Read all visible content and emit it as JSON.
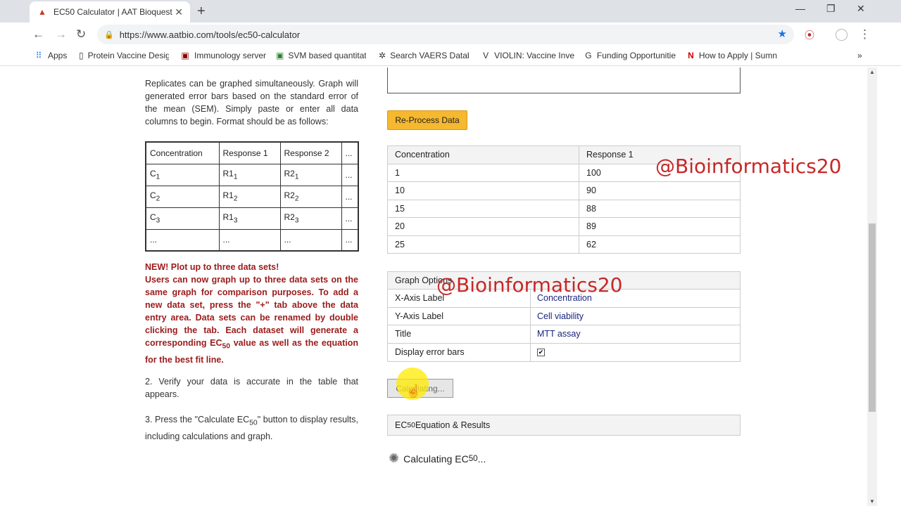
{
  "browser": {
    "tab_title": "EC50 Calculator | AAT Bioquest",
    "new_tab": "+",
    "url": "https://www.aatbio.com/tools/ec50-calculator",
    "bookmarks": [
      "Apps",
      "Protein Vaccine Desig",
      "Immunology server",
      "SVM based quantitat",
      "Search VAERS Databa",
      "VIOLIN: Vaccine Inve",
      "Funding Opportunitie",
      "How to Apply | Sumn"
    ],
    "more_bookmarks": "»"
  },
  "left": {
    "intro": "Replicates can be graphed simultaneously. Graph will generated error bars based on the standard error of the mean (SEM). Simply paste or enter all data columns to begin. Format should be as follows:",
    "format_table": {
      "headers": [
        "Concentration",
        "Response 1",
        "Response 2",
        "..."
      ],
      "rows": [
        {
          "c": "C",
          "cs": "1",
          "r1": "R1",
          "r1s": "1",
          "r2": "R2",
          "r2s": "1",
          "more": "..."
        },
        {
          "c": "C",
          "cs": "2",
          "r1": "R1",
          "r1s": "2",
          "r2": "R2",
          "r2s": "2",
          "more": "..."
        },
        {
          "c": "C",
          "cs": "3",
          "r1": "R1",
          "r1s": "3",
          "r2": "R2",
          "r2s": "3",
          "more": "..."
        },
        {
          "c": "...",
          "cs": "",
          "r1": "...",
          "r1s": "",
          "r2": "...",
          "r2s": "",
          "more": "..."
        }
      ]
    },
    "new_heading": "NEW! Plot up to three data sets!",
    "new_body_a": "Users can now graph up to three data sets on the same graph for comparison purposes. To add a new data set, press the \"+\" tab above the data entry area. Data sets can be renamed by double clicking the tab. Each dataset will generate a corresponding EC",
    "new_body_sub": "50",
    "new_body_b": " value as well as the equation for the best fit line.",
    "step2": "2. Verify your data is accurate in the table that appears.",
    "step3_a": "3. Press the \"Calculate EC",
    "step3_sub": "50",
    "step3_b": "\" button to display results, including calculations and graph."
  },
  "right": {
    "reprocess_label": "Re-Process Data",
    "data_table": {
      "headers": [
        "Concentration",
        "Response 1"
      ],
      "rows": [
        [
          "1",
          "100"
        ],
        [
          "10",
          "90"
        ],
        [
          "15",
          "88"
        ],
        [
          "20",
          "89"
        ],
        [
          "25",
          "62"
        ]
      ]
    },
    "graph_options": {
      "heading": "Graph Options",
      "x_label": "X-Axis Label",
      "x_value": "Concentration",
      "y_label": "Y-Axis Label",
      "y_value": "Cell viability",
      "title_label": "Title",
      "title_value": "MTT assay",
      "error_label": "Display error bars",
      "error_checked": "✔"
    },
    "calc_button": "Calculating...",
    "results_a": "EC",
    "results_sub": "50",
    "results_b": " Equation & Results",
    "loading_a": "Calculating EC",
    "loading_sub": "50",
    "loading_b": " ..."
  },
  "watermarks": [
    "@Bioinformatics20",
    "@Bioinformatics20"
  ],
  "colors": {
    "accent_button": "#f5b82e",
    "note_red": "#9c1b1b",
    "watermark": "#c62828",
    "highlight": "#ffeb00"
  }
}
